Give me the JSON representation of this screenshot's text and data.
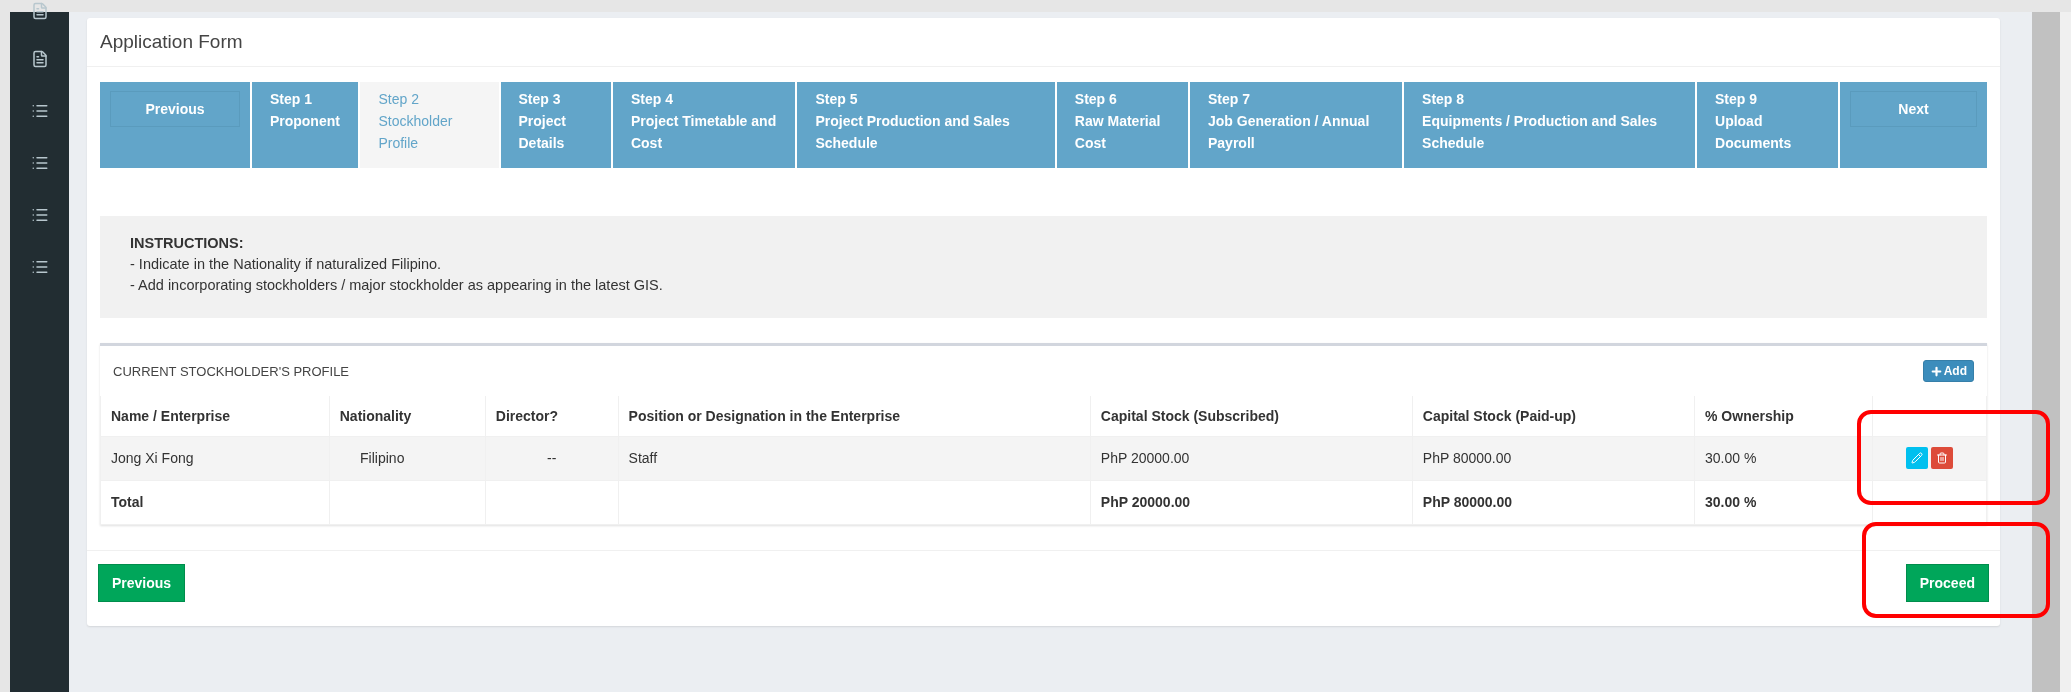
{
  "card": {
    "title": "Application Form"
  },
  "steps": [
    {
      "kind": "nav",
      "label": "Previous"
    },
    {
      "kind": "step",
      "number": "Step 1",
      "title": "Proponent",
      "selected": false
    },
    {
      "kind": "step",
      "number": "Step 2",
      "title": "Stockholder Profile",
      "selected": true
    },
    {
      "kind": "step",
      "number": "Step 3",
      "title": "Project Details",
      "selected": false
    },
    {
      "kind": "step",
      "number": "Step 4",
      "title": "Project Timetable and Cost",
      "selected": false
    },
    {
      "kind": "step",
      "number": "Step 5",
      "title": "Project Production and Sales Schedule",
      "selected": false
    },
    {
      "kind": "step",
      "number": "Step 6",
      "title": "Raw Material Cost",
      "selected": false
    },
    {
      "kind": "step",
      "number": "Step 7",
      "title": "Job Generation / Annual Payroll",
      "selected": false
    },
    {
      "kind": "step",
      "number": "Step 8",
      "title": "Equipments / Production and Sales Schedule",
      "selected": false
    },
    {
      "kind": "step",
      "number": "Step 9",
      "title": "Upload Documents",
      "selected": false
    },
    {
      "kind": "nav",
      "label": "Next"
    }
  ],
  "instructions": {
    "heading": "INSTRUCTIONS:",
    "lines": [
      "- Indicate in the Nationality if naturalized Filipino.",
      "- Add incorporating stockholders / major stockholder as appearing in the latest GIS."
    ]
  },
  "table": {
    "title": "CURRENT STOCKHOLDER'S PROFILE",
    "add_button": "Add",
    "columns": [
      "Name / Enterprise",
      "Nationality",
      "Director?",
      "Position or Designation in the Enterprise",
      "Capital Stock (Subscribed)",
      "Capital Stock (Paid-up)",
      "% Ownership"
    ],
    "actions_highlighted": true,
    "rows": [
      {
        "kind": "data",
        "cells": [
          "Jong Xi Fong",
          "Filipino",
          "--",
          "Staff",
          "PhP 20000.00",
          "PhP 80000.00",
          "30.00 %"
        ]
      },
      {
        "kind": "total",
        "cells": [
          "Total",
          "",
          "",
          "",
          "PhP 20000.00",
          "PhP 80000.00",
          "30.00 %"
        ]
      }
    ]
  },
  "footer": {
    "previous": "Previous",
    "proceed": "Proceed",
    "proceed_highlighted": true
  }
}
